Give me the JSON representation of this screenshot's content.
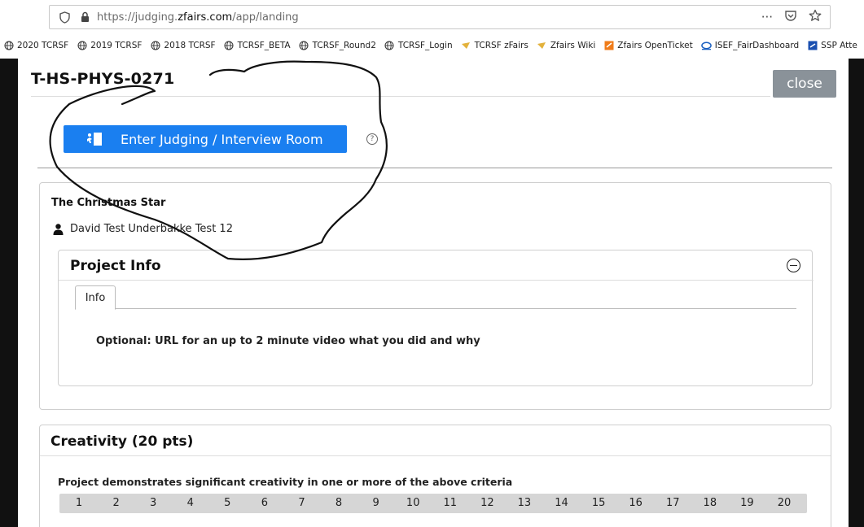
{
  "browser": {
    "url_prefix": "https://judging.",
    "url_host": "zfairs.com",
    "url_path": "/app/landing",
    "menu_glyph": "···"
  },
  "bookmarks": [
    {
      "label": "2020 TCRSF",
      "icon": "globe-icon"
    },
    {
      "label": "2019 TCRSF",
      "icon": "globe-icon"
    },
    {
      "label": "2018 TCRSF",
      "icon": "globe-icon"
    },
    {
      "label": "TCRSF_BETA",
      "icon": "globe-icon"
    },
    {
      "label": "TCRSF_Round2",
      "icon": "globe-icon"
    },
    {
      "label": "TCRSF_Login",
      "icon": "globe-icon"
    },
    {
      "label": "TCRSF zFairs",
      "icon": "zfairs-icon"
    },
    {
      "label": "Zfairs Wiki",
      "icon": "zfairs-icon"
    },
    {
      "label": "Zfairs OpenTicket",
      "icon": "ticket-icon"
    },
    {
      "label": "ISEF_FairDashboard",
      "icon": "isef-icon"
    },
    {
      "label": "SSP Atte",
      "icon": "ssp-icon"
    }
  ],
  "modal": {
    "title": "T-HS-PHYS-0271",
    "close_label": "close",
    "enter_label": "Enter Judging / Interview Room",
    "help_glyph": "?"
  },
  "project": {
    "title": "The Christmas Star",
    "student": "David Test Underbakke Test 12",
    "info_heading": "Project Info",
    "tab_label": "Info",
    "info_text": "Optional: URL for an up to 2 minute video what you did and why"
  },
  "creativity": {
    "heading": "Creativity (20 pts)",
    "question": "Project demonstrates significant creativity in one or more of the above criteria",
    "points": [
      "1",
      "2",
      "3",
      "4",
      "5",
      "6",
      "7",
      "8",
      "9",
      "10",
      "11",
      "12",
      "13",
      "14",
      "15",
      "16",
      "17",
      "18",
      "19",
      "20"
    ]
  },
  "colors": {
    "enter_button": "#1a7ff0",
    "close_button": "#8a9299",
    "backdrop": "#111111"
  }
}
